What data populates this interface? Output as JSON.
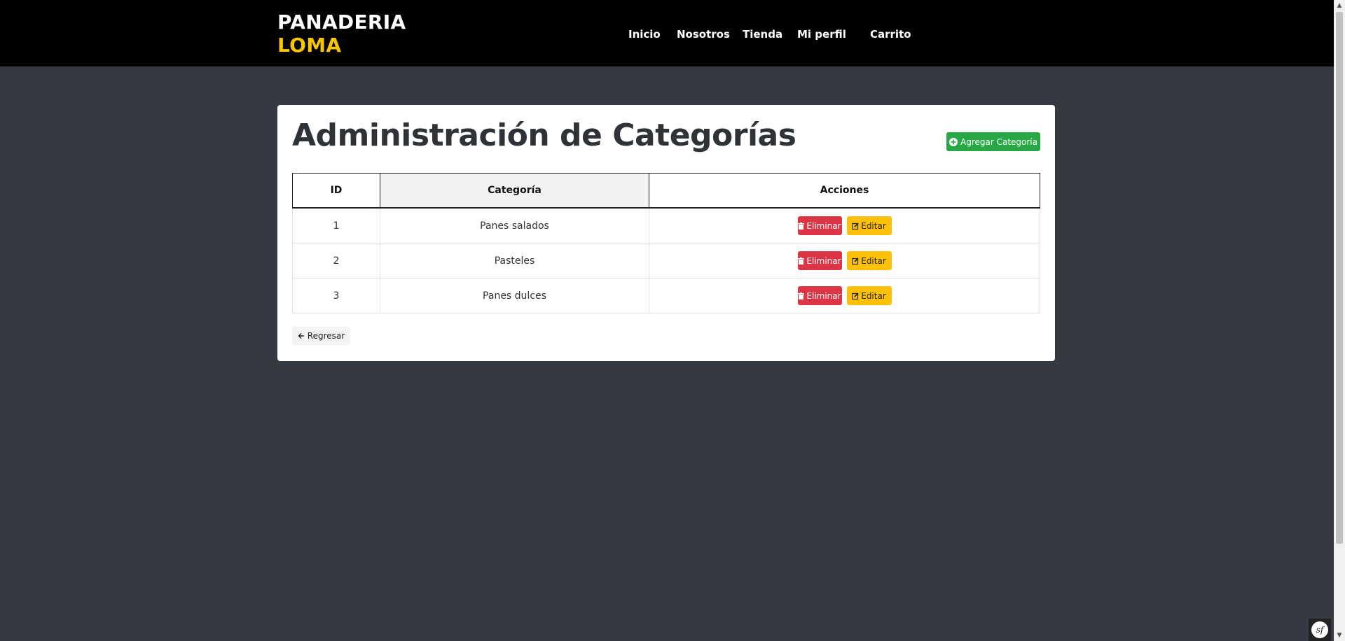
{
  "brand": {
    "line1": "PANADERIA",
    "line2": "LOMA"
  },
  "nav": [
    {
      "label": "Inicio"
    },
    {
      "label": "Nosotros"
    },
    {
      "label": "Tienda"
    },
    {
      "label": "Mi perfil"
    },
    {
      "label": "Carrito"
    }
  ],
  "main": {
    "title": "Administración de Categorías",
    "add_button": "Agregar Categoría",
    "back_button": "Regresar",
    "table": {
      "headers": [
        "ID",
        "Categoría",
        "Acciones"
      ],
      "rows": [
        {
          "id": "1",
          "category": "Panes salados"
        },
        {
          "id": "2",
          "category": "Pasteles"
        },
        {
          "id": "3",
          "category": "Panes dulces"
        }
      ],
      "delete_label": "Eliminar",
      "edit_label": "Editar"
    }
  },
  "colors": {
    "header_bg": "#000000",
    "brand_accent": "#f7c600",
    "page_bg": "#353a42",
    "add_button": "#28a745",
    "delete_button": "#dc3545",
    "edit_button": "#ffc107"
  },
  "icons": {
    "add": "plus-circle-icon",
    "delete": "trash-icon",
    "edit": "edit-icon",
    "back": "arrow-left-icon"
  },
  "toolbar_badge": "sf"
}
